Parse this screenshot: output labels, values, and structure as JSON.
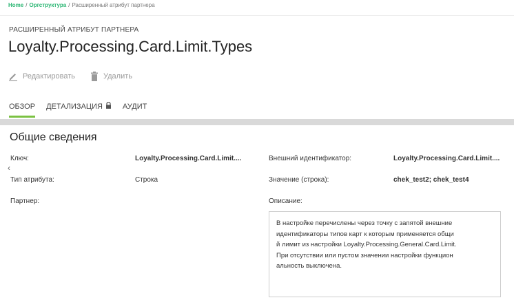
{
  "breadcrumb": {
    "home": "Home",
    "separator": "/",
    "org": "Оргструктура",
    "current": "Расширенный атрибут партнера"
  },
  "header": {
    "subtitle": "РАСШИРЕННЫЙ АТРИБУТ ПАРТНЕРА",
    "title": "Loyalty.Processing.Card.Limit.Types"
  },
  "actions": {
    "edit": "Редактировать",
    "delete": "Удалить"
  },
  "tabs": {
    "overview": "ОБЗОР",
    "details": "ДЕТАЛИЗАЦИЯ",
    "audit": "АУДИТ"
  },
  "section": {
    "title": "Общие сведения"
  },
  "fields": {
    "key_label": "Ключ:",
    "key_value": "Loyalty.Processing.Card.Limit....",
    "type_label": "Тип атрибута:",
    "type_value": "Строка",
    "partner_label": "Партнер:",
    "ext_id_label": "Внешний идентификатор:",
    "ext_id_value": "Loyalty.Processing.Card.Limit....",
    "string_value_label": "Значение (строка):",
    "string_value": "chek_test2; chek_test4",
    "description_label": "Описание:",
    "description": "В настройке перечислены через точку с запятой внешние\nидентификаторы типов карт к которым применяется общи\nй лимит из настройки Loyalty.Processing.General.Card.Limit.\nПри отсутствии или пустом значении настройки функцион\nальность выключена."
  },
  "colors": {
    "accent": "#7bc142",
    "link": "#2bb673"
  }
}
